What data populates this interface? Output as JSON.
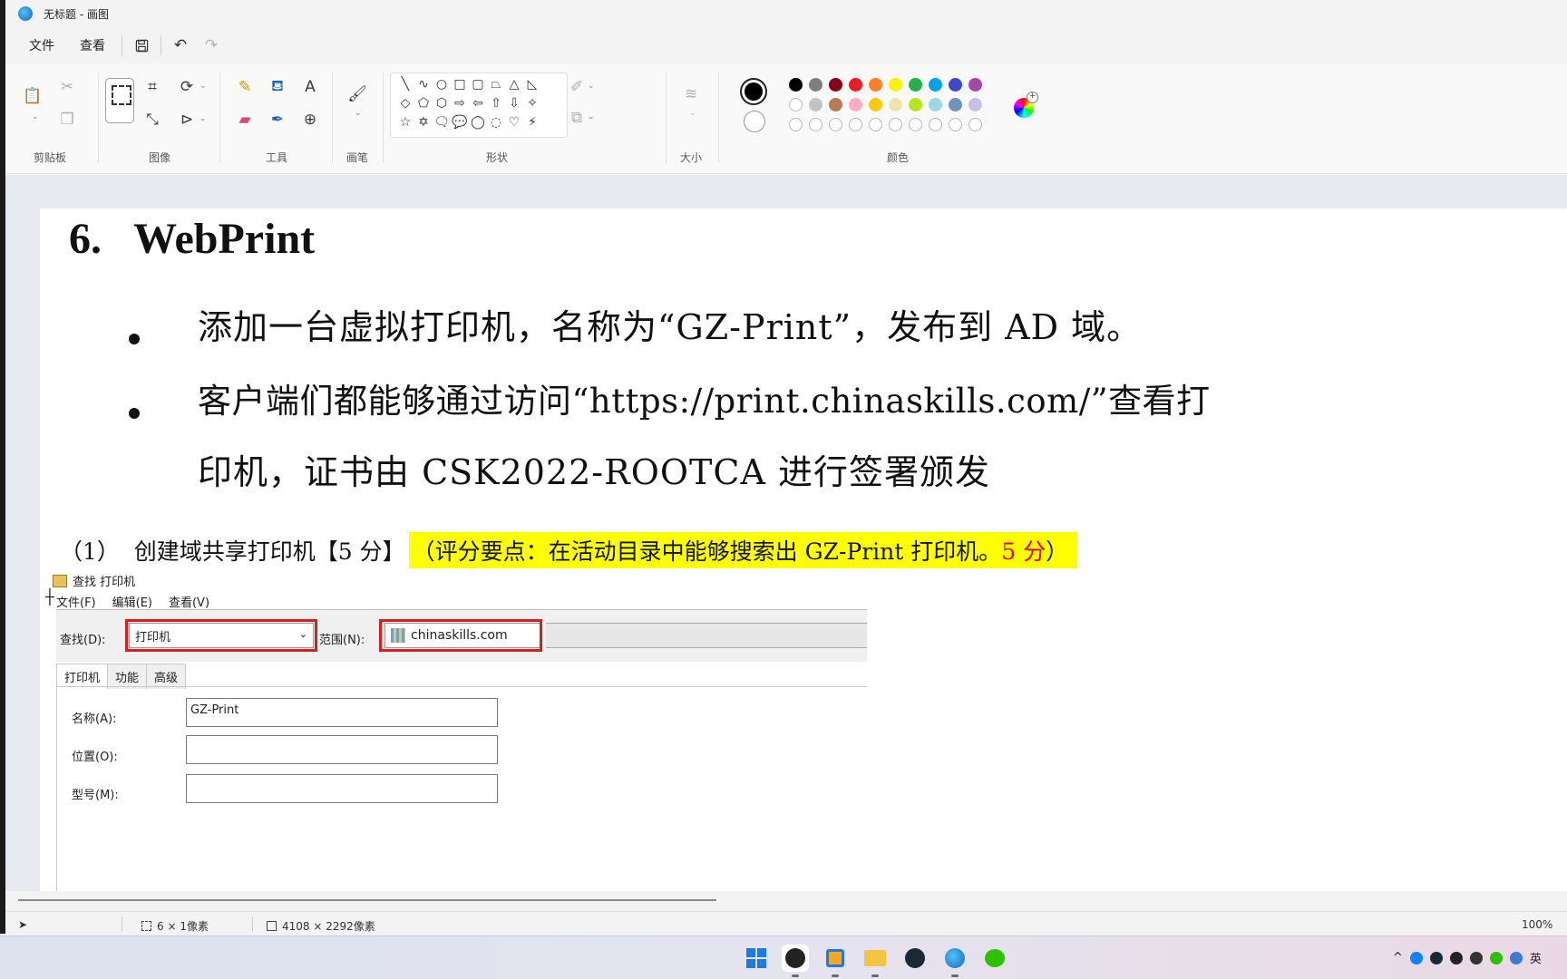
{
  "window": {
    "title": "无标题 - 画图"
  },
  "menu": {
    "file": "文件",
    "view": "查看"
  },
  "ribbon": {
    "groups": {
      "clipboard": "剪贴板",
      "image": "图像",
      "tools": "工具",
      "brush": "画笔",
      "shapes": "形状",
      "size": "大小",
      "colors": "颜色"
    },
    "tool_glyphs": {
      "text": "A"
    },
    "colors": {
      "primary": "#000000",
      "secondary": "#ffffff",
      "row1": [
        "#000000",
        "#7f7f7f",
        "#880015",
        "#ed1c24",
        "#ff7f27",
        "#fff200",
        "#22b14c",
        "#00a2e8",
        "#3f48cc",
        "#a349a4"
      ],
      "row2": [
        "#ffffff",
        "#c3c3c3",
        "#b97a57",
        "#ffaec9",
        "#ffc90e",
        "#efe4b0",
        "#b5e61d",
        "#99d9ea",
        "#7092be",
        "#c8bfe7"
      ],
      "row3_empty_count": 10
    }
  },
  "document": {
    "heading": "6.   WebPrint",
    "bullet1": "添加一台虚拟打印机，名称为“GZ-Print”，发布到 AD 域。",
    "bullet2_line1": "客户端们都能够通过访问“https://print.chinaskills.com/”查看打",
    "bullet2_line2": "印机，证书由 CSK2022-ROOTCA 进行签署颁发",
    "sub_prefix": "（1）  创建域共享打印机【5 分】",
    "sub_highlight_a": "（评分要点：在活动目录中能够搜索出 GZ-Print 打印机。",
    "sub_highlight_red": "5 分",
    "sub_highlight_b": "）"
  },
  "embedded_dialog": {
    "title": "查找 打印机",
    "menu": [
      "文件(F)",
      "编辑(E)",
      "查看(V)"
    ],
    "find_label": "查找(D):",
    "find_value": "打印机",
    "scope_label": "范围(N):",
    "scope_value": "chinaskills.com",
    "tabs": [
      "打印机",
      "功能",
      "高级"
    ],
    "fields": [
      {
        "label": "名称(A):",
        "value": "GZ-Print"
      },
      {
        "label": "位置(O):",
        "value": ""
      },
      {
        "label": "型号(M):",
        "value": ""
      }
    ]
  },
  "status": {
    "selection": "6 × 1像素",
    "image_size": "4108 × 2292像素",
    "zoom": "100%"
  },
  "taskbar": {
    "tray_lang": "英"
  }
}
